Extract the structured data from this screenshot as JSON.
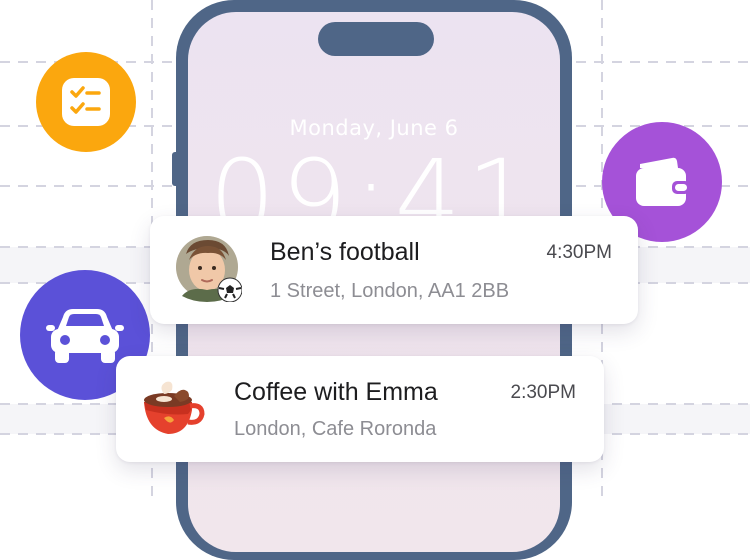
{
  "lockscreen": {
    "date": "Monday, June 6",
    "time": "09:41"
  },
  "app_bubbles": [
    {
      "icon": "checklist-icon",
      "color": "#fba70e"
    },
    {
      "icon": "wallet-icon",
      "color": "#a552d8"
    },
    {
      "icon": "car-icon",
      "color": "#5b51d8"
    }
  ],
  "notifications": [
    {
      "title": "Ben’s football",
      "subtitle": "1 Street, London, AA1 2BB",
      "time": "4:30PM",
      "icon": "avatar-with-football-icon"
    },
    {
      "title": "Coffee with Emma",
      "subtitle": "London, Cafe Roronda",
      "time": "2:30PM",
      "icon": "coffee-cup-icon"
    }
  ],
  "colors": {
    "phone_frame": "#4f6687",
    "screen_tint": "#ece3f1"
  }
}
